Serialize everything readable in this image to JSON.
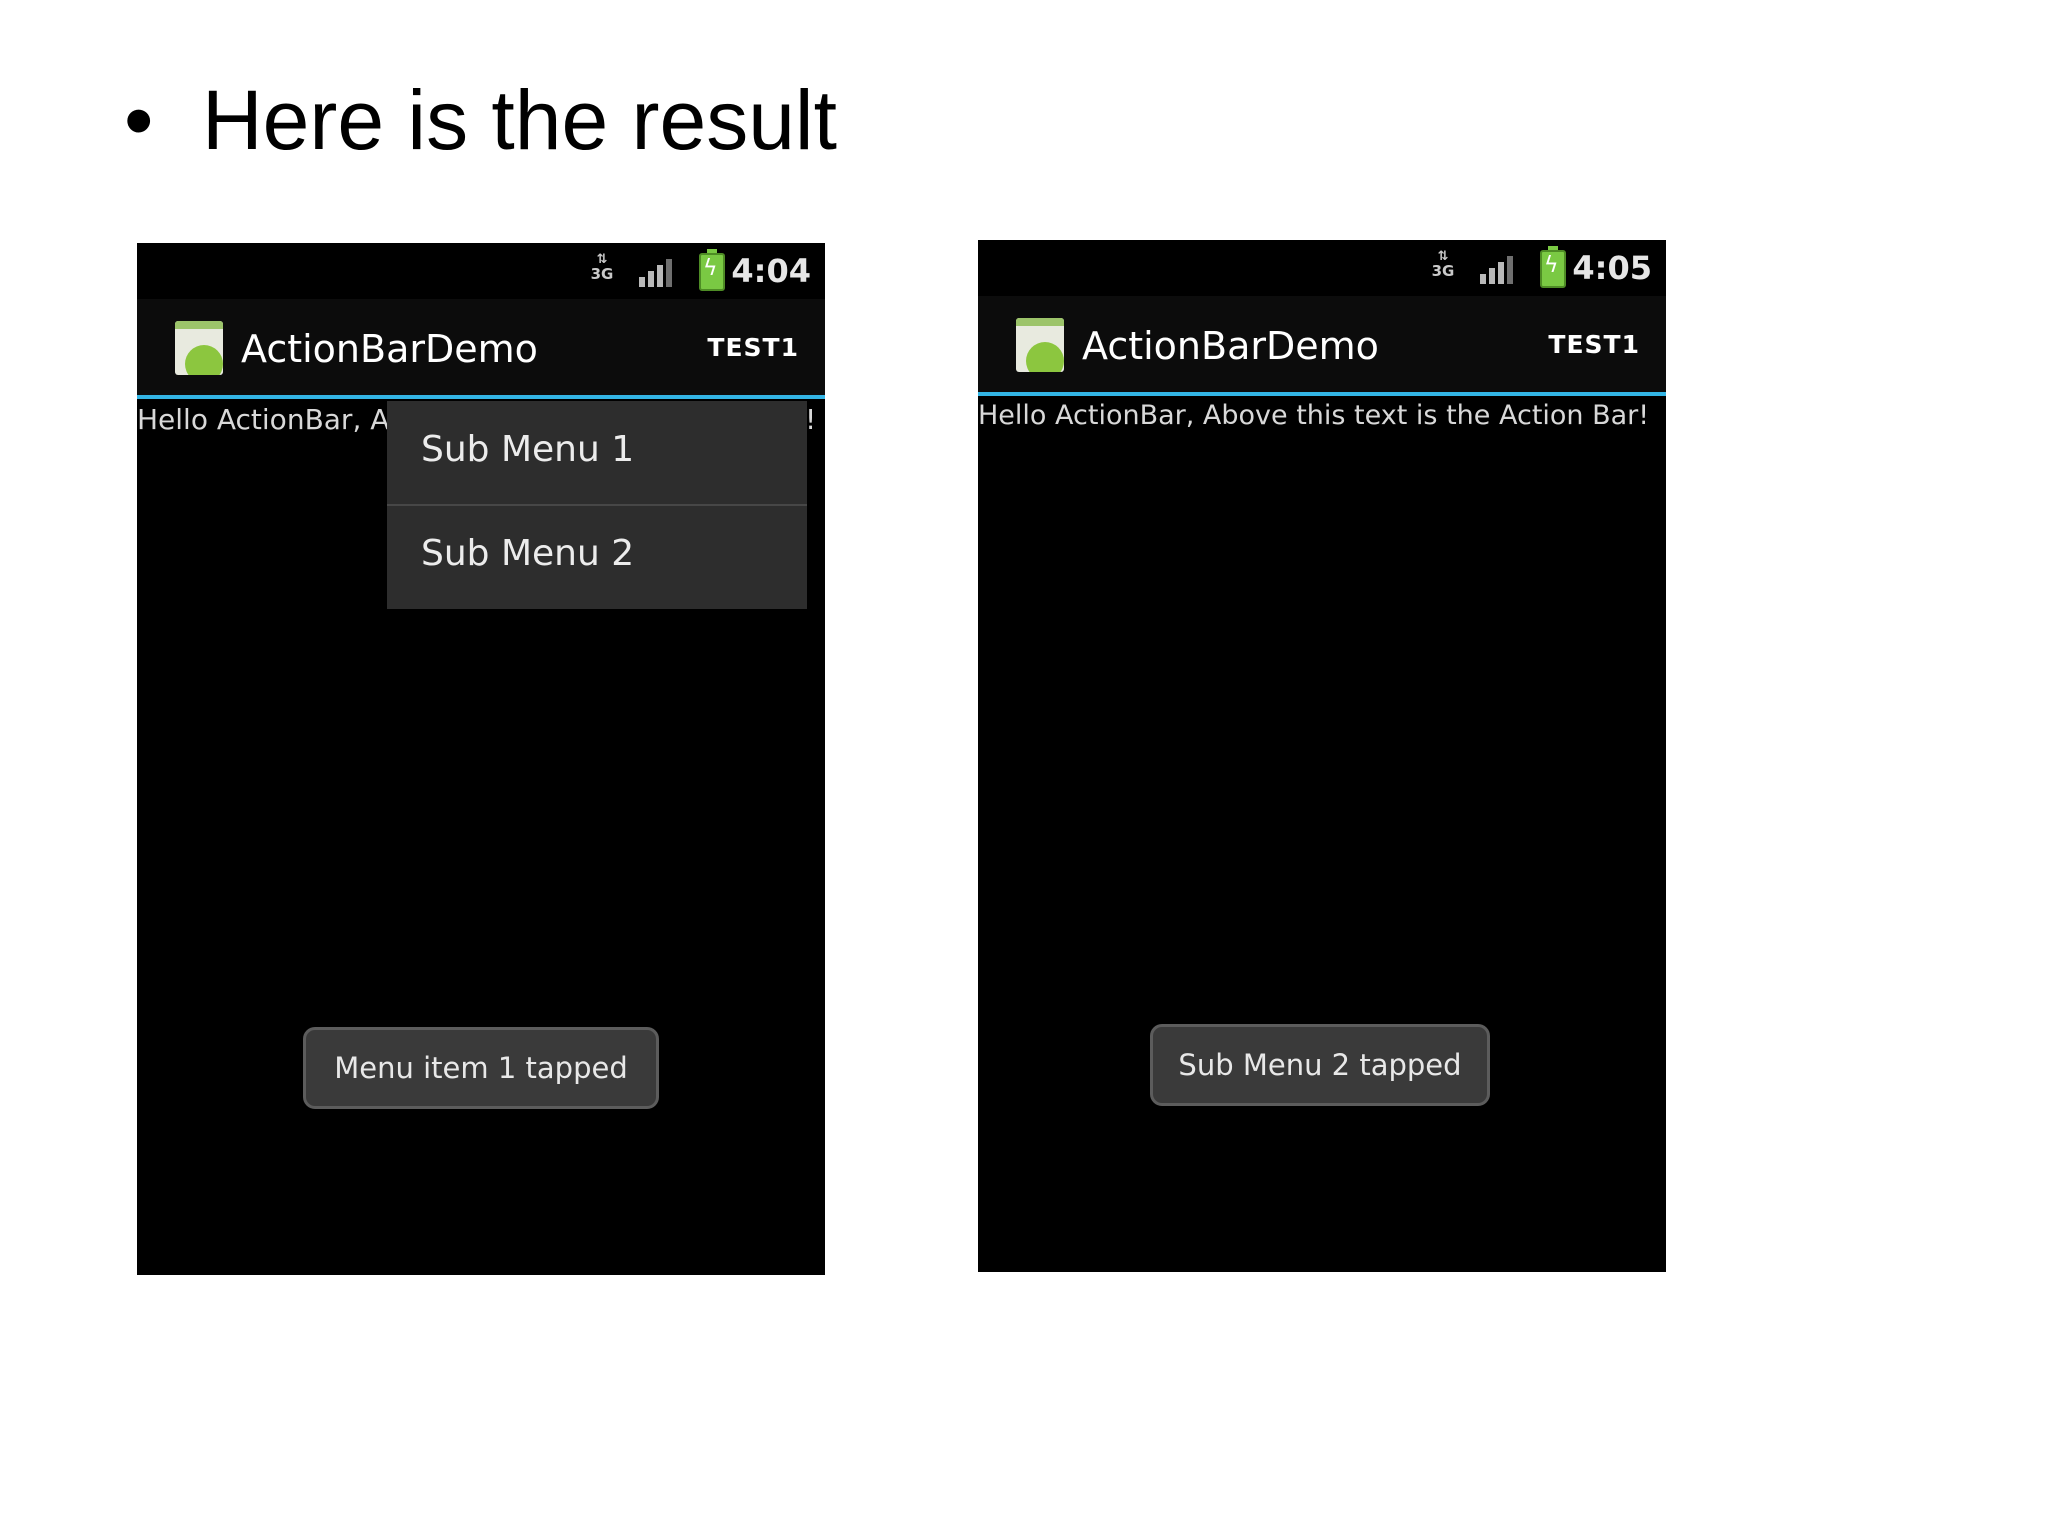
{
  "slide": {
    "bullet": "•",
    "heading": "Here is the result"
  },
  "screens": [
    {
      "status": {
        "network": "3G",
        "time": "4:04"
      },
      "action_bar": {
        "title": "ActionBarDemo",
        "action_item": "TEST1"
      },
      "content_text_visible": "Hello ActionBar, A",
      "content_text_tail": "!",
      "submenu": [
        "Sub Menu 1",
        "Sub Menu 2"
      ],
      "toast": "Menu item 1 tapped"
    },
    {
      "status": {
        "network": "3G",
        "time": "4:05"
      },
      "action_bar": {
        "title": "ActionBarDemo",
        "action_item": "TEST1"
      },
      "content_text": "Hello ActionBar, Above this text is the Action Bar!",
      "toast": "Sub Menu 2 tapped"
    }
  ],
  "colors": {
    "accent_line": "#33b5e5",
    "battery": "#7ac943"
  }
}
